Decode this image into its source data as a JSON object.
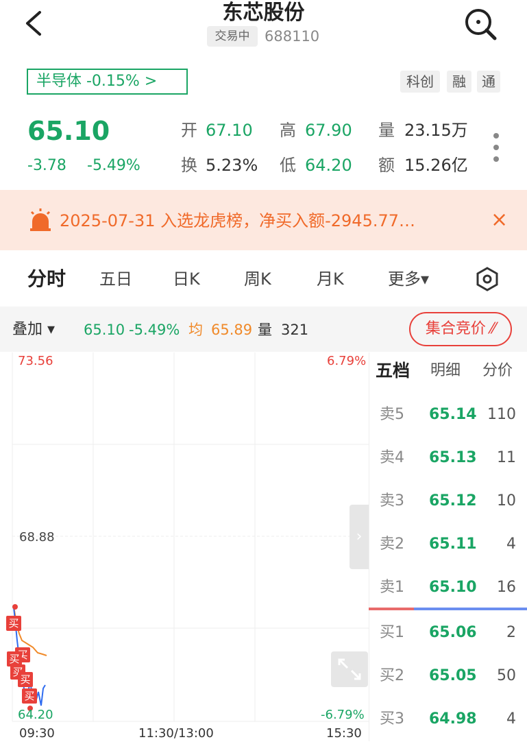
{
  "header": {
    "title": "东芯股份",
    "status": "交易中",
    "code": "688110"
  },
  "sector": {
    "label": "半导体 -0.15%  >"
  },
  "tags": [
    "科创",
    "融",
    "通"
  ],
  "quote": {
    "price": "65.10",
    "change": "-3.78",
    "change_pct": "-5.49%",
    "open_label": "开",
    "open": "67.10",
    "high_label": "高",
    "high": "67.90",
    "vol_label": "量",
    "vol": "23.15万",
    "turnover_label": "换",
    "turnover": "5.23%",
    "low_label": "低",
    "low": "64.20",
    "amount_label": "额",
    "amount": "15.26亿"
  },
  "notice": {
    "text": "2025-07-31 入选龙虎榜，净买入额-2945.77…",
    "close": "×"
  },
  "tabs": [
    "分时",
    "五日",
    "日K",
    "周K",
    "月K",
    "更多▾"
  ],
  "overlay": {
    "label": "叠加 ▾",
    "price": "65.10",
    "pct": "-5.49%",
    "avg_label": "均",
    "avg": "65.89",
    "vol_label": "量",
    "vol": "321",
    "auction": "集合竞价"
  },
  "chart": {
    "y_top": "73.56",
    "y_mid": "68.88",
    "y_bottom": "64.20",
    "pct_top": "6.79%",
    "pct_bottom": "-6.79%",
    "x_start": "09:30",
    "x_mid": "11:30/13:00",
    "x_end": "15:30",
    "buy_tag": "买"
  },
  "book": {
    "tabs": [
      "五档",
      "明细",
      "分价"
    ],
    "rows": [
      {
        "label": "卖5",
        "price": "65.14",
        "qty": "110"
      },
      {
        "label": "卖4",
        "price": "65.13",
        "qty": "11"
      },
      {
        "label": "卖3",
        "price": "65.12",
        "qty": "10"
      },
      {
        "label": "卖2",
        "price": "65.11",
        "qty": "4"
      },
      {
        "label": "卖1",
        "price": "65.10",
        "qty": "16"
      },
      {
        "label": "买1",
        "price": "65.06",
        "qty": "2"
      },
      {
        "label": "买2",
        "price": "65.05",
        "qty": "50"
      },
      {
        "label": "买3",
        "price": "64.98",
        "qty": "4"
      }
    ]
  },
  "colors": {
    "green": "#1aa564",
    "red": "#e8403a",
    "orange": "#f06a2a"
  }
}
